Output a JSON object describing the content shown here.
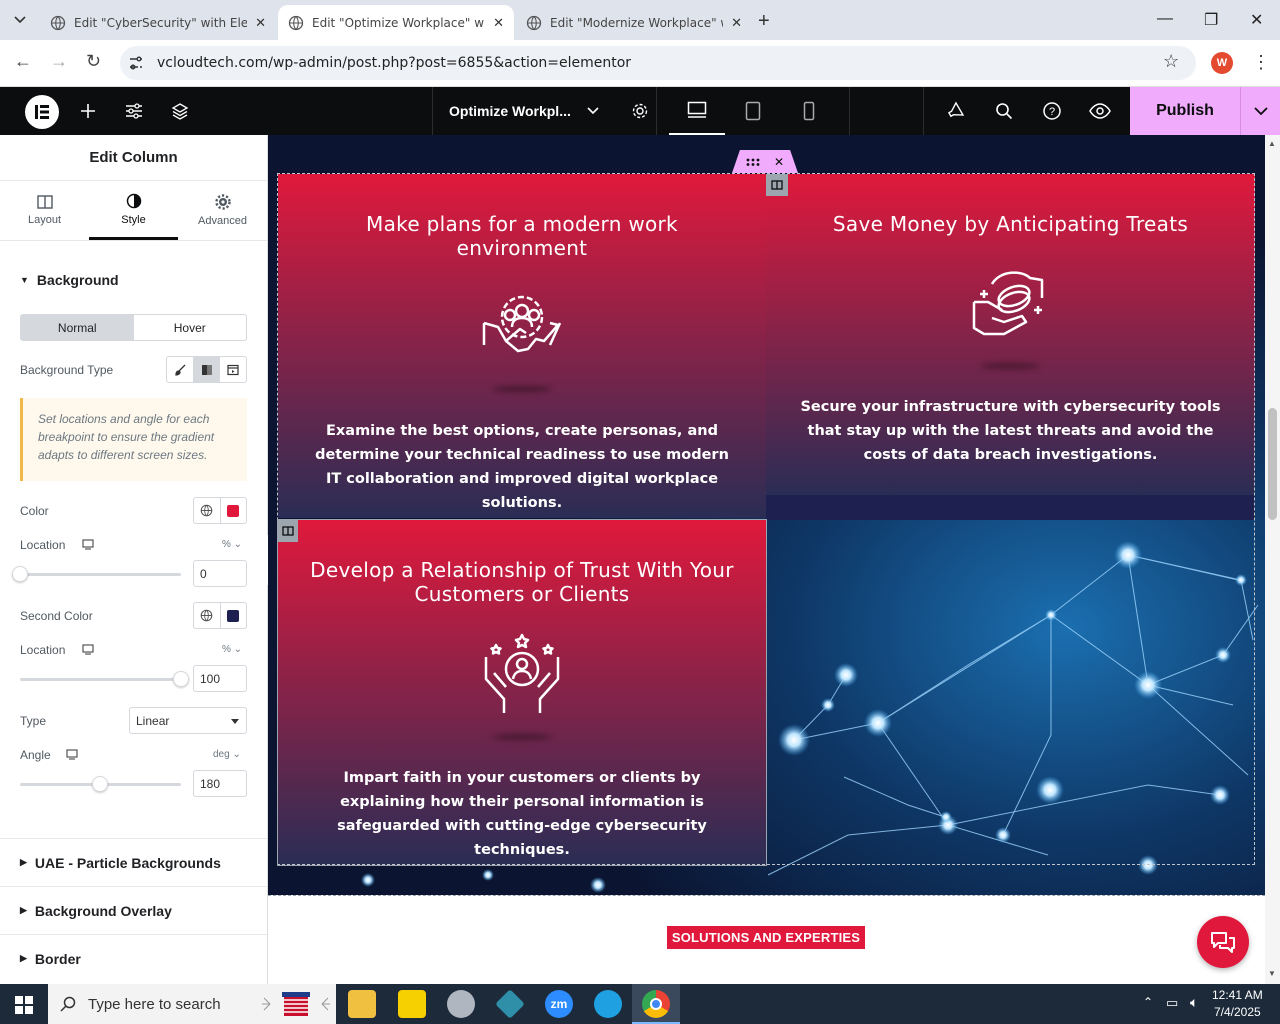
{
  "browser": {
    "tabs": [
      {
        "title": "Edit \"CyberSecurity\" with Eleme",
        "active": false
      },
      {
        "title": "Edit \"Optimize Workplace\" with",
        "active": true
      },
      {
        "title": "Edit \"Modernize Workplace\" wi",
        "active": false
      }
    ],
    "url": "vcloudtech.com/wp-admin/post.php?post=6855&action=elementor",
    "profile_initial": "W"
  },
  "editor_top": {
    "document_title": "Optimize Workpl...",
    "publish_label": "Publish"
  },
  "panel": {
    "title": "Edit Column",
    "tabs": [
      "Layout",
      "Style",
      "Advanced"
    ],
    "active_tab": "Style",
    "section_background": "Background",
    "state_tabs": [
      "Normal",
      "Hover"
    ],
    "background_type_label": "Background Type",
    "notice": "Set locations and angle for each breakpoint to ensure the gradient adapts to different screen sizes.",
    "color_label": "Color",
    "color_value": "#e0193c",
    "location_label": "Location",
    "location_unit": "%",
    "location_value": "0",
    "second_color_label": "Second Color",
    "second_color_value": "#1e2150",
    "location2_label": "Location",
    "location2_unit": "%",
    "location2_value": "100",
    "type_label": "Type",
    "type_value": "Linear",
    "angle_label": "Angle",
    "angle_unit": "deg",
    "angle_value": "180",
    "accordions": [
      "UAE - Particle Backgrounds",
      "Background Overlay",
      "Border"
    ]
  },
  "cards": [
    {
      "title": "Make plans for a modern work environment",
      "text": "Examine the best options, create personas, and determine your technical readiness to use modern IT collaboration and improved digital workplace solutions.",
      "icon": "handshake-team-icon"
    },
    {
      "title": "Save Money by Anticipating Treats",
      "text": "Secure your infrastructure with cybersecurity tools that stay up with the latest threats and avoid the costs of data breach investigations.",
      "icon": "hand-coins-icon"
    },
    {
      "title": "Develop a Relationship of Trust With Your Customers or Clients",
      "text": "Impart faith in your customers or clients by explaining how their personal information is safeguarded with cutting-edge cybersecurity techniques.",
      "icon": "hands-person-stars-icon"
    }
  ],
  "solutions_label": "SOLUTIONS AND EXPERTIES",
  "taskbar": {
    "search_placeholder": "Type here to search",
    "time": "12:41 AM",
    "date": "7/4/2025"
  },
  "colors": {
    "accent_red": "#e0193c",
    "elementor_pink": "#f0abfc",
    "dark_navy": "#0b1430"
  }
}
